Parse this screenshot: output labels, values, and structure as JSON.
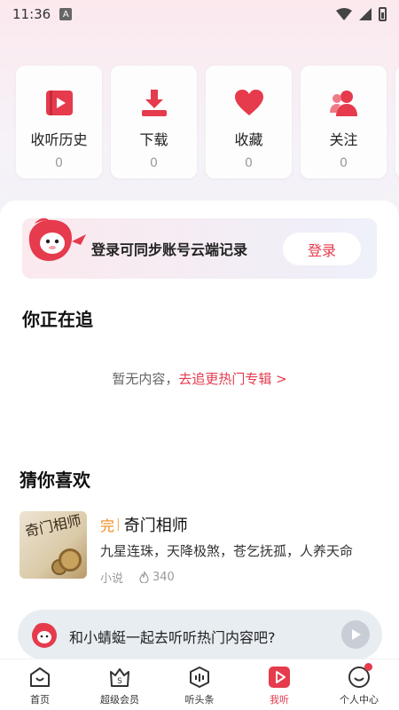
{
  "status_bar": {
    "time": "11:36",
    "notif_icon": "A"
  },
  "quick_actions": [
    {
      "icon": "play-history-icon",
      "label": "收听历史",
      "count": "0"
    },
    {
      "icon": "download-icon",
      "label": "下载",
      "count": "0"
    },
    {
      "icon": "heart-icon",
      "label": "收藏",
      "count": "0"
    },
    {
      "icon": "user-follow-icon",
      "label": "关注",
      "count": "0"
    }
  ],
  "login_banner": {
    "text": "登录可同步账号云端记录",
    "button": "登录"
  },
  "following": {
    "title": "你正在追",
    "empty_text": "暂无内容，",
    "empty_link": "去追更热门专辑 >"
  },
  "recommend": {
    "title": "猜你喜欢",
    "book": {
      "tag": "完",
      "title": "奇门相师",
      "desc": "九星连珠，天降极煞，苍乞抚孤，人养天命",
      "category": "小说",
      "plays": "340",
      "cover_text": "奇门相师"
    }
  },
  "chat": {
    "text": "和小蜻蜓一起去听听热门内容吧?"
  },
  "tabs": [
    {
      "label": "首页",
      "icon": "home-icon"
    },
    {
      "label": "超级会员",
      "icon": "vip-icon"
    },
    {
      "label": "听头条",
      "icon": "headline-icon"
    },
    {
      "label": "我听",
      "icon": "my-listen-icon",
      "active": true
    },
    {
      "label": "个人中心",
      "icon": "profile-icon"
    }
  ],
  "colors": {
    "accent": "#e53b4d",
    "tag_orange": "#f08a1c"
  }
}
